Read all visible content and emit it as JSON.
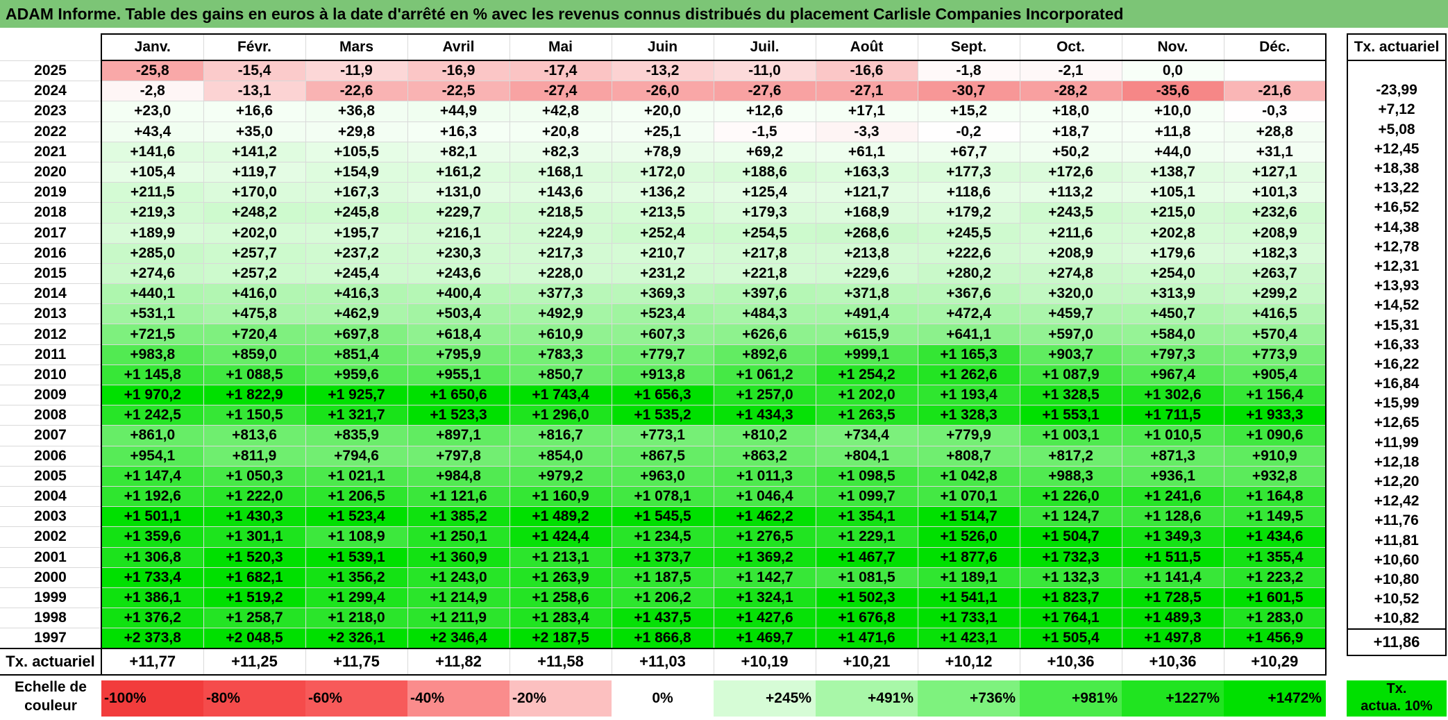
{
  "title": "ADAM Informe. Table des gains en euros à la date d'arrêté en % avec les revenus connus distribués du placement Carlisle Companies Incorporated",
  "chart_data": {
    "type": "table",
    "title": "ADAM Informe. Table des gains en euros à la date d'arrêté en % avec les revenus connus distribués du placement Carlisle Companies Incorporated",
    "columns": [
      "Janv.",
      "Févr.",
      "Mars",
      "Avril",
      "Mai",
      "Juin",
      "Juil.",
      "Août",
      "Sept.",
      "Oct.",
      "Nov.",
      "Déc."
    ],
    "side_header": "Tx. actuariel",
    "rows": [
      {
        "year": "2025",
        "values": [
          "-25,8",
          "-15,4",
          "-11,9",
          "-16,9",
          "-17,4",
          "-13,2",
          "-11,0",
          "-16,6",
          "-1,8",
          "-2,1",
          "0,0",
          ""
        ],
        "tx": ""
      },
      {
        "year": "2024",
        "values": [
          "-2,8",
          "-13,1",
          "-22,6",
          "-22,5",
          "-27,4",
          "-26,0",
          "-27,6",
          "-27,1",
          "-30,7",
          "-28,2",
          "-35,6",
          "-21,6"
        ],
        "tx": "-23,99"
      },
      {
        "year": "2023",
        "values": [
          "+23,0",
          "+16,6",
          "+36,8",
          "+44,9",
          "+42,8",
          "+20,0",
          "+12,6",
          "+17,1",
          "+15,2",
          "+18,0",
          "+10,0",
          "-0,3"
        ],
        "tx": "+7,12"
      },
      {
        "year": "2022",
        "values": [
          "+43,4",
          "+35,0",
          "+29,8",
          "+16,3",
          "+20,8",
          "+25,1",
          "-1,5",
          "-3,3",
          "-0,2",
          "+18,7",
          "+11,8",
          "+28,8"
        ],
        "tx": "+5,08"
      },
      {
        "year": "2021",
        "values": [
          "+141,6",
          "+141,2",
          "+105,5",
          "+82,1",
          "+82,3",
          "+78,9",
          "+69,2",
          "+61,1",
          "+67,7",
          "+50,2",
          "+44,0",
          "+31,1"
        ],
        "tx": "+12,45"
      },
      {
        "year": "2020",
        "values": [
          "+105,4",
          "+119,7",
          "+154,9",
          "+161,2",
          "+168,1",
          "+172,0",
          "+188,6",
          "+163,3",
          "+177,3",
          "+172,6",
          "+138,7",
          "+127,1"
        ],
        "tx": "+18,38"
      },
      {
        "year": "2019",
        "values": [
          "+211,5",
          "+170,0",
          "+167,3",
          "+131,0",
          "+143,6",
          "+136,2",
          "+125,4",
          "+121,7",
          "+118,6",
          "+113,2",
          "+105,1",
          "+101,3"
        ],
        "tx": "+13,22"
      },
      {
        "year": "2018",
        "values": [
          "+219,3",
          "+248,2",
          "+245,8",
          "+229,7",
          "+218,5",
          "+213,5",
          "+179,3",
          "+168,9",
          "+179,2",
          "+243,5",
          "+215,0",
          "+232,6"
        ],
        "tx": "+16,52"
      },
      {
        "year": "2017",
        "values": [
          "+189,9",
          "+202,0",
          "+195,7",
          "+216,1",
          "+224,9",
          "+252,4",
          "+254,5",
          "+268,6",
          "+245,5",
          "+211,6",
          "+202,8",
          "+208,9"
        ],
        "tx": "+14,38"
      },
      {
        "year": "2016",
        "values": [
          "+285,0",
          "+257,7",
          "+237,2",
          "+230,3",
          "+217,3",
          "+210,7",
          "+217,8",
          "+213,8",
          "+222,6",
          "+208,9",
          "+179,6",
          "+182,3"
        ],
        "tx": "+12,78"
      },
      {
        "year": "2015",
        "values": [
          "+274,6",
          "+257,2",
          "+245,4",
          "+243,6",
          "+228,0",
          "+231,2",
          "+221,8",
          "+229,6",
          "+280,2",
          "+274,8",
          "+254,0",
          "+263,7"
        ],
        "tx": "+12,31"
      },
      {
        "year": "2014",
        "values": [
          "+440,1",
          "+416,0",
          "+416,3",
          "+400,4",
          "+377,3",
          "+369,3",
          "+397,6",
          "+371,8",
          "+367,6",
          "+320,0",
          "+313,9",
          "+299,2"
        ],
        "tx": "+13,93"
      },
      {
        "year": "2013",
        "values": [
          "+531,1",
          "+475,8",
          "+462,9",
          "+503,4",
          "+492,9",
          "+523,4",
          "+484,3",
          "+491,4",
          "+472,4",
          "+459,7",
          "+450,7",
          "+416,5"
        ],
        "tx": "+14,52"
      },
      {
        "year": "2012",
        "values": [
          "+721,5",
          "+720,4",
          "+697,8",
          "+618,4",
          "+610,9",
          "+607,3",
          "+626,6",
          "+615,9",
          "+641,1",
          "+597,0",
          "+584,0",
          "+570,4"
        ],
        "tx": "+15,31"
      },
      {
        "year": "2011",
        "values": [
          "+983,8",
          "+859,0",
          "+851,4",
          "+795,9",
          "+783,3",
          "+779,7",
          "+892,6",
          "+999,1",
          "+1 165,3",
          "+903,7",
          "+797,3",
          "+773,9"
        ],
        "tx": "+16,33"
      },
      {
        "year": "2010",
        "values": [
          "+1 145,8",
          "+1 088,5",
          "+959,6",
          "+955,1",
          "+850,7",
          "+913,8",
          "+1 061,2",
          "+1 254,2",
          "+1 262,6",
          "+1 087,9",
          "+967,4",
          "+905,4"
        ],
        "tx": "+16,22"
      },
      {
        "year": "2009",
        "values": [
          "+1 970,2",
          "+1 822,9",
          "+1 925,7",
          "+1 650,6",
          "+1 743,4",
          "+1 656,3",
          "+1 257,0",
          "+1 202,0",
          "+1 193,4",
          "+1 328,5",
          "+1 302,6",
          "+1 156,4"
        ],
        "tx": "+16,84"
      },
      {
        "year": "2008",
        "values": [
          "+1 242,5",
          "+1 150,5",
          "+1 321,7",
          "+1 523,3",
          "+1 296,0",
          "+1 535,2",
          "+1 434,3",
          "+1 263,5",
          "+1 328,3",
          "+1 553,1",
          "+1 711,5",
          "+1 933,3"
        ],
        "tx": "+15,99"
      },
      {
        "year": "2007",
        "values": [
          "+861,0",
          "+813,6",
          "+835,9",
          "+897,1",
          "+816,7",
          "+773,1",
          "+810,2",
          "+734,4",
          "+779,9",
          "+1 003,1",
          "+1 010,5",
          "+1 090,6"
        ],
        "tx": "+12,65"
      },
      {
        "year": "2006",
        "values": [
          "+954,1",
          "+811,9",
          "+794,6",
          "+797,8",
          "+854,0",
          "+867,5",
          "+863,2",
          "+804,1",
          "+808,7",
          "+817,2",
          "+871,3",
          "+910,9"
        ],
        "tx": "+11,99"
      },
      {
        "year": "2005",
        "values": [
          "+1 147,4",
          "+1 050,3",
          "+1 021,1",
          "+984,8",
          "+979,2",
          "+963,0",
          "+1 011,3",
          "+1 098,5",
          "+1 042,8",
          "+988,3",
          "+936,1",
          "+932,8"
        ],
        "tx": "+12,18"
      },
      {
        "year": "2004",
        "values": [
          "+1 192,6",
          "+1 222,0",
          "+1 206,5",
          "+1 121,6",
          "+1 160,9",
          "+1 078,1",
          "+1 046,4",
          "+1 099,7",
          "+1 070,1",
          "+1 226,0",
          "+1 241,6",
          "+1 164,8"
        ],
        "tx": "+12,20"
      },
      {
        "year": "2003",
        "values": [
          "+1 501,1",
          "+1 430,3",
          "+1 523,4",
          "+1 385,2",
          "+1 489,2",
          "+1 545,5",
          "+1 462,2",
          "+1 354,1",
          "+1 514,7",
          "+1 124,7",
          "+1 128,6",
          "+1 149,5"
        ],
        "tx": "+12,42"
      },
      {
        "year": "2002",
        "values": [
          "+1 359,6",
          "+1 301,1",
          "+1 108,9",
          "+1 250,1",
          "+1 424,4",
          "+1 234,5",
          "+1 276,5",
          "+1 229,1",
          "+1 526,0",
          "+1 504,7",
          "+1 349,3",
          "+1 434,6"
        ],
        "tx": "+11,76"
      },
      {
        "year": "2001",
        "values": [
          "+1 306,8",
          "+1 520,3",
          "+1 539,1",
          "+1 360,9",
          "+1 213,1",
          "+1 373,7",
          "+1 369,2",
          "+1 467,7",
          "+1 877,6",
          "+1 732,3",
          "+1 511,5",
          "+1 355,4"
        ],
        "tx": "+11,81"
      },
      {
        "year": "2000",
        "values": [
          "+1 733,4",
          "+1 682,1",
          "+1 356,2",
          "+1 243,0",
          "+1 263,9",
          "+1 187,5",
          "+1 142,7",
          "+1 081,5",
          "+1 189,1",
          "+1 132,3",
          "+1 141,4",
          "+1 223,2"
        ],
        "tx": "+10,60"
      },
      {
        "year": "1999",
        "values": [
          "+1 386,1",
          "+1 519,2",
          "+1 299,4",
          "+1 214,9",
          "+1 258,6",
          "+1 206,2",
          "+1 324,1",
          "+1 502,3",
          "+1 541,1",
          "+1 823,7",
          "+1 728,5",
          "+1 601,5"
        ],
        "tx": "+10,80"
      },
      {
        "year": "1998",
        "values": [
          "+1 376,2",
          "+1 258,7",
          "+1 218,0",
          "+1 211,9",
          "+1 283,4",
          "+1 437,5",
          "+1 427,6",
          "+1 676,8",
          "+1 733,1",
          "+1 764,1",
          "+1 489,3",
          "+1 283,0"
        ],
        "tx": "+10,52"
      },
      {
        "year": "1997",
        "values": [
          "+2 373,8",
          "+2 048,5",
          "+2 326,1",
          "+2 346,4",
          "+2 187,5",
          "+1 866,8",
          "+1 469,7",
          "+1 471,6",
          "+1 423,1",
          "+1 505,4",
          "+1 497,8",
          "+1 456,9"
        ],
        "tx": "+10,82"
      }
    ],
    "footer": {
      "label": "Tx. actuariel",
      "values": [
        "+11,77",
        "+11,25",
        "+11,75",
        "+11,82",
        "+11,58",
        "+11,03",
        "+10,19",
        "+10,21",
        "+10,12",
        "+10,36",
        "+10,36",
        "+10,29"
      ],
      "tx": "+11,86"
    },
    "scale": {
      "label_line1": "Echelle de",
      "label_line2": "couleur",
      "stops": [
        {
          "label": "-100%",
          "color": "#f23c3c",
          "kind": "neg"
        },
        {
          "label": "-80%",
          "color": "#f54b4b",
          "kind": "neg"
        },
        {
          "label": "-60%",
          "color": "#f75a5a",
          "kind": "neg"
        },
        {
          "label": "-40%",
          "color": "#fa8c8c",
          "kind": "neg"
        },
        {
          "label": "-20%",
          "color": "#fcc0c0",
          "kind": "neg"
        },
        {
          "label": "0%",
          "color": "#ffffff",
          "kind": "zero"
        },
        {
          "label": "+245%",
          "color": "#d6fcd6",
          "kind": "pos"
        },
        {
          "label": "+491%",
          "color": "#a8f7a8",
          "kind": "pos"
        },
        {
          "label": "+736%",
          "color": "#7ef27e",
          "kind": "pos"
        },
        {
          "label": "+981%",
          "color": "#4aeb4a",
          "kind": "pos"
        },
        {
          "label": "+1227%",
          "color": "#20e420",
          "kind": "pos"
        },
        {
          "label": "+1472%",
          "color": "#00e000",
          "kind": "pos"
        }
      ],
      "tx_line1": "Tx.",
      "tx_line2": "actua. 10%"
    }
  }
}
